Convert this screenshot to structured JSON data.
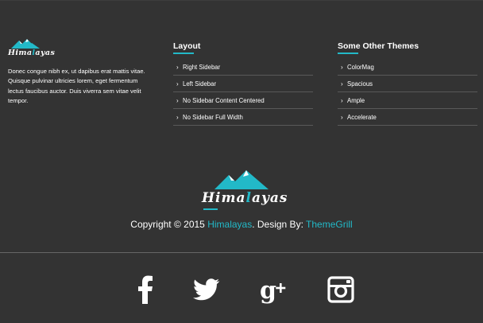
{
  "footer": {
    "about": {
      "logo_text_main": "Hima",
      "logo_text_accent": "l",
      "logo_text_end": "ayas",
      "text": "Donec congue nibh ex, ut dapibus erat mattis vitae. Quisque pulvinar ultricies lorem, eget fermentum lectus faucibus auctor. Duis viverra sem vitae velit tempor."
    },
    "layout": {
      "title": "Layout",
      "items": [
        "Right Sidebar",
        "Left Sidebar",
        "No Sidebar Content Centered",
        "No Sidebar Full Width"
      ]
    },
    "themes": {
      "title": "Some Other Themes",
      "items": [
        "ColorMag",
        "Spacious",
        "Ample",
        "Accelerate"
      ]
    },
    "center_logo": {
      "text_main": "Hima",
      "text_accent": "l",
      "text_end": "ayas"
    },
    "copyright": {
      "prefix": "Copyright © 2015 ",
      "site": "Himalayas",
      "middle": ". Design By: ",
      "designer": "ThemeGrill"
    },
    "social": [
      "facebook-icon",
      "twitter-icon",
      "google-plus-icon",
      "instagram-icon"
    ],
    "colors": {
      "background": "#333333",
      "accent": "#22b9c8",
      "text": "#ffffff"
    }
  }
}
